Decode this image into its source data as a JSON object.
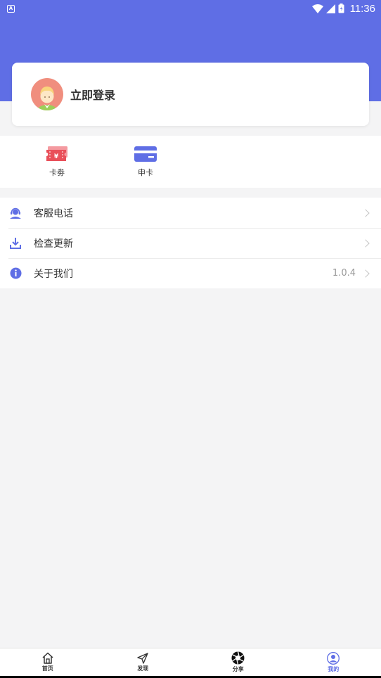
{
  "status_bar": {
    "time": "11:36",
    "notification_icon": "A"
  },
  "login": {
    "label": "立即登录",
    "avatar_icon": "user-avatar"
  },
  "quick_actions": [
    {
      "label": "卡劵",
      "icon": "coupon-ticket-icon",
      "color": "#e9505a"
    },
    {
      "label": "申卡",
      "icon": "credit-card-icon",
      "color": "#5f6ee5"
    }
  ],
  "menu": {
    "items": [
      {
        "label": "客服电话",
        "icon": "customer-service-icon"
      },
      {
        "label": "检查更新",
        "icon": "download-icon"
      },
      {
        "label": "关于我们",
        "icon": "info-icon",
        "value": "1.0.4"
      }
    ]
  },
  "tabbar": {
    "tabs": [
      {
        "label": "首页",
        "icon": "home-icon"
      },
      {
        "label": "发现",
        "icon": "send-icon"
      },
      {
        "label": "分享",
        "icon": "shutter-icon"
      },
      {
        "label": "我的",
        "icon": "user-icon",
        "active": true
      }
    ]
  },
  "colors": {
    "primary": "#5f6ee5",
    "accent_red": "#e9505a",
    "background": "#f4f4f5"
  }
}
